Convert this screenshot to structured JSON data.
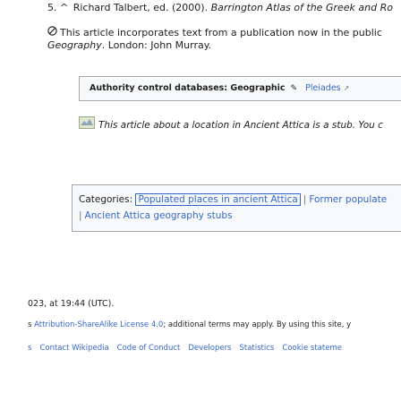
{
  "reference": {
    "number": "5.",
    "caret": "^",
    "text_before": " Richard Talbert, ed. (2000). ",
    "title": "Barrington Atlas of the Greek and Ro"
  },
  "public_domain": {
    "icon": "public-domain-icon",
    "text": "This article incorporates text from a publication now in the public",
    "italic": "Geography",
    "rest": ". London: John Murray."
  },
  "authority": {
    "label": "Authority control databases: Geographic",
    "pleiades": "Pleiades"
  },
  "stub": {
    "text": "This article about a location in Ancient Attica is a stub. You c"
  },
  "categories": {
    "label": "Categories:",
    "items": [
      "Populated places in ancient Attica",
      "Former populate",
      "Ancient Attica geography stubs"
    ]
  },
  "footer": {
    "edited": "023, at 19:44 (UTC).",
    "license_prefix": "s ",
    "license_link": "Attribution-ShareAlike License 4.0",
    "license_rest": "; additional terms may apply. By using this site, y",
    "links": [
      "s",
      "Contact Wikipedia",
      "Code of Conduct",
      "Developers",
      "Statistics",
      "Cookie stateme"
    ]
  }
}
